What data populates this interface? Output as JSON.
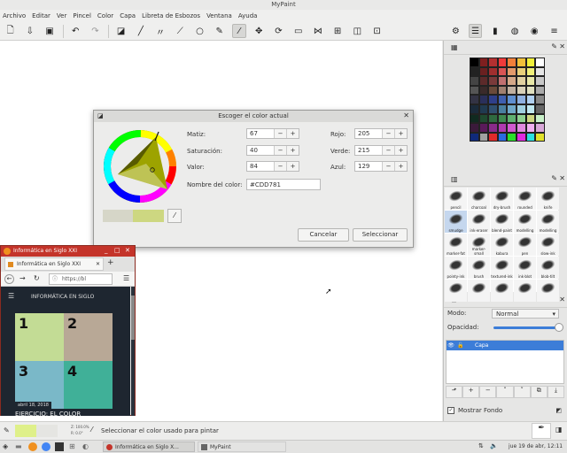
{
  "window": {
    "title": "MyPaint"
  },
  "menu": [
    "Archivo",
    "Editar",
    "Ver",
    "Pincel",
    "Color",
    "Capa",
    "Libreta de Esbozos",
    "Ventana",
    "Ayuda"
  ],
  "dialog": {
    "title": "Escoger el color actual",
    "hue_label": "Matiz:",
    "hue_value": "67",
    "sat_label": "Saturación:",
    "sat_value": "40",
    "val_label": "Valor:",
    "val_value": "84",
    "red_label": "Rojo:",
    "red_value": "205",
    "green_label": "Verde:",
    "green_value": "215",
    "blue_label": "Azul:",
    "blue_value": "129",
    "name_label": "Nombre del color:",
    "name_value": "#CDD781",
    "cancel": "Cancelar",
    "select": "Seleccionar",
    "current_color": "#cdd781",
    "previous_color": "#d6d6c8"
  },
  "palette_colors": [
    "#000000",
    "#7f1f1f",
    "#b43030",
    "#f03a3a",
    "#f07f3a",
    "#f0c03a",
    "#f0f03a",
    "#ffffff",
    "#222222",
    "#6a2020",
    "#a02e2e",
    "#d95454",
    "#e29a6b",
    "#e8d07a",
    "#f0f07a",
    "#e6e6e6",
    "#444444",
    "#5c2a2a",
    "#7a3a3a",
    "#c07070",
    "#d4a888",
    "#e0d0a0",
    "#e8e8a8",
    "#c8c8c8",
    "#555555",
    "#3a2a2a",
    "#6a4a3a",
    "#a08070",
    "#c0b0a0",
    "#d8d0b8",
    "#e0e0c0",
    "#aaaaaa",
    "#333344",
    "#2a2f5a",
    "#2f3f8a",
    "#3f5fb0",
    "#5f8fd0",
    "#8fb0e0",
    "#b0d0f0",
    "#888888",
    "#1a2a3a",
    "#203a50",
    "#305070",
    "#4a80a0",
    "#70a8c8",
    "#a0d0e0",
    "#c0e8f0",
    "#666666",
    "#102a20",
    "#1f4a30",
    "#2f6a40",
    "#3f8a50",
    "#5fb070",
    "#8fd090",
    "#cdd781",
    "#c8f0c8",
    "#3a1a3a",
    "#5a1a5a",
    "#8a2a8a",
    "#b03ab0",
    "#d05ad0",
    "#e08ae0",
    "#f0b0f0",
    "#d8a8d8",
    "#102a7a",
    "#a0a0a0",
    "#e02a2a",
    "#2a6ae0",
    "#2ae02a",
    "#e02ae0",
    "#2ae0e0",
    "#e0e02a"
  ],
  "brushes": [
    "pencil",
    "charcoal",
    "dry-brush",
    "rounded",
    "knife",
    "smudge",
    "ink-eraser",
    "blend-paint",
    "modelling",
    "modelling",
    "marker-fat",
    "marker-small",
    "kabura",
    "pen",
    "slow-ink",
    "pointy-ink",
    "brush",
    "textured-ink",
    "ink-blot",
    "blob-tilt",
    "",
    "",
    "",
    "",
    ""
  ],
  "layers": {
    "mode_label": "Modo:",
    "mode_value": "Normal",
    "opacity_label": "Opacidad:",
    "opacity": 1.0,
    "items": [
      {
        "name": "Capa"
      }
    ],
    "show_background": "Mostrar Fondo"
  },
  "status": {
    "zoom": "Z: 100.0%",
    "rotation": "R: 0.0°",
    "hint": "Seleccionar el color usado para pintar"
  },
  "browser": {
    "window_title": "Informática en Siglo XXI",
    "tab_title": "Informática en Siglo XXI",
    "url": "https://bl",
    "site_header": "INFORMÁTICA EN SIGLO",
    "quad1": "1",
    "quad2": "2",
    "quad3": "3",
    "quad4": "4",
    "date": "abril 18, 2018",
    "post_title": "EJERCICIO: EL COLOR"
  },
  "taskbar": {
    "app1": "Informática en Siglo X...",
    "app2": "MyPaint",
    "clock": "jue 19 de abr, 12:11"
  }
}
